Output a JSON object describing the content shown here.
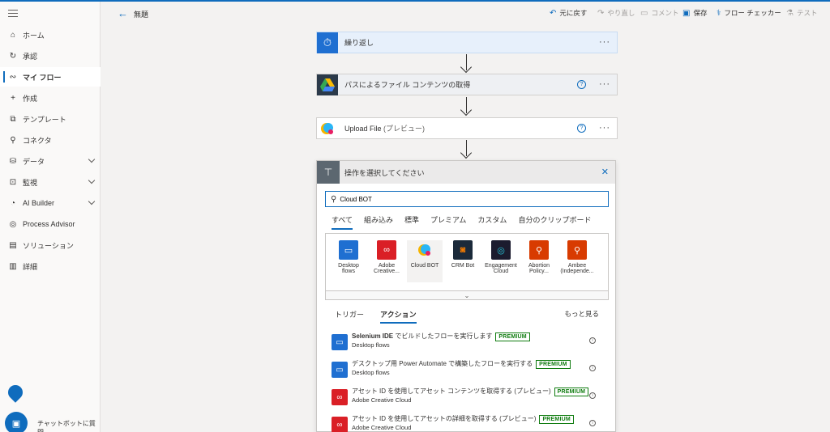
{
  "header": {
    "flow_title": "無題",
    "undo_label": "元に戻す",
    "redo_label": "やり直し",
    "comment_label": "コメント",
    "save_label": "保存",
    "flow_checker_label": "フロー チェッカー",
    "test_label": "テスト"
  },
  "sidebar": {
    "items": [
      {
        "label": "ホーム",
        "icon": "home-icon"
      },
      {
        "label": "承認",
        "icon": "approvals-icon"
      },
      {
        "label": "マイ フロー",
        "icon": "my-flows-icon"
      },
      {
        "label": "作成",
        "icon": "plus-icon"
      },
      {
        "label": "テンプレート",
        "icon": "template-icon"
      },
      {
        "label": "コネクタ",
        "icon": "connector-icon"
      },
      {
        "label": "データ",
        "icon": "database-icon"
      },
      {
        "label": "監視",
        "icon": "monitor-icon"
      },
      {
        "label": "AI Builder",
        "icon": "ai-builder-icon"
      },
      {
        "label": "Process Advisor",
        "icon": "process-advisor-icon"
      },
      {
        "label": "ソリューション",
        "icon": "solutions-icon"
      },
      {
        "label": "詳細",
        "icon": "details-icon"
      }
    ],
    "active_item": "マイ フロー",
    "chatbot_label": "チャットボットに質問"
  },
  "canvas": {
    "steps": [
      {
        "label": "繰り返し",
        "icon": "recurrence-icon"
      },
      {
        "label": "パスによるファイル コンテンツの取得",
        "icon": "google-drive-icon"
      },
      {
        "label": "Upload File",
        "suffix": " (プレビュー)",
        "icon": "cloud-bot-icon"
      }
    ]
  },
  "chooser": {
    "title": "操作を選択してください",
    "search_value": "Cloud BOT",
    "tabs": [
      "すべて",
      "組み込み",
      "標準",
      "プレミアム",
      "カスタム",
      "自分のクリップボード"
    ],
    "active_tab": "すべて",
    "connectors": [
      {
        "line1": "Desktop",
        "line2": "flows",
        "color": "#1f6fd1"
      },
      {
        "line1": "Adobe",
        "line2": "Creative...",
        "color": "#da1f26"
      },
      {
        "line1": "Cloud BOT",
        "line2": "",
        "color": "#ffffff"
      },
      {
        "line1": "CRM Bot",
        "line2": "",
        "color": "#1b2a3a"
      },
      {
        "line1": "Engagement",
        "line2": "Cloud",
        "color": "#1b1b2e"
      },
      {
        "line1": "Abortion",
        "line2": "Policy...",
        "color": "#d83b01"
      },
      {
        "line1": "Ambee",
        "line2": "(Independe...",
        "color": "#d83b01"
      }
    ],
    "subtabs": [
      "トリガー",
      "アクション"
    ],
    "active_subtab": "アクション",
    "see_more": "もっと見る",
    "premium_badge": "PREMIUM",
    "actions": [
      {
        "title_bold": "Selenium IDE",
        "title_rest": " でビルドしたフローを実行します",
        "sub": "Desktop flows",
        "color": "#1f6fd1"
      },
      {
        "title_bold": "",
        "title_rest": "デスクトップ用 Power Automate で構築したフローを実行する",
        "sub": "Desktop flows",
        "color": "#1f6fd1"
      },
      {
        "title_bold": "",
        "title_rest": "アセット ID を使用してアセット コンテンツを取得する (プレビュー)",
        "sub": "Adobe Creative Cloud",
        "color": "#da1f26"
      },
      {
        "title_bold": "",
        "title_rest": "アセット ID を使用してアセットの詳細を取得する (プレビュー)",
        "sub": "Adobe Creative Cloud",
        "color": "#da1f26"
      }
    ]
  }
}
